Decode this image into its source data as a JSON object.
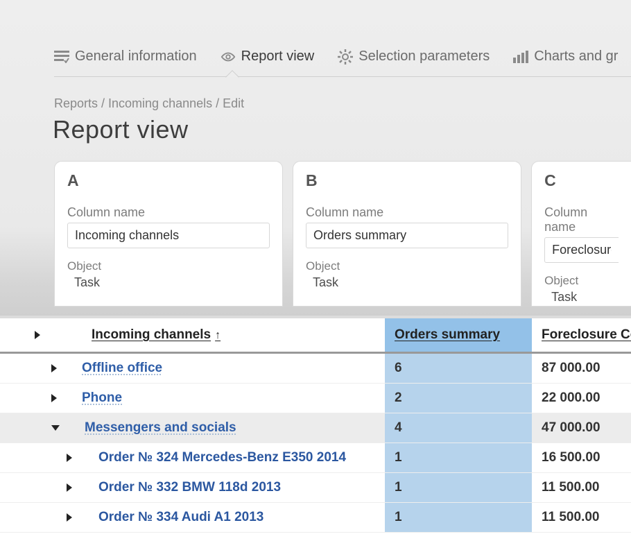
{
  "tabs": {
    "general": "General information",
    "report": "Report view",
    "selection": "Selection parameters",
    "charts": "Charts and gr"
  },
  "breadcrumbs": "Reports / Incoming channels / Edit",
  "page_title": "Report view",
  "columns": [
    {
      "letter": "A",
      "name_label": "Column name",
      "name_value": "Incoming channels",
      "object_label": "Object",
      "object_value": "Task"
    },
    {
      "letter": "B",
      "name_label": "Column name",
      "name_value": "Orders summary",
      "object_label": "Object",
      "object_value": "Task"
    },
    {
      "letter": "C",
      "name_label": "Column name",
      "name_value": "Foreclosure Co",
      "object_label": "Object",
      "object_value": "Task"
    }
  ],
  "table": {
    "headers": {
      "a": "Incoming channels",
      "b": "Orders summary",
      "c": "Foreclosure Co"
    },
    "sort_indicator": "↑",
    "rows": [
      {
        "label": "Offline office",
        "orders": "6",
        "cost": "87 000.00",
        "expanded": false,
        "level": 0
      },
      {
        "label": "Phone",
        "orders": "2",
        "cost": "22 000.00",
        "expanded": false,
        "level": 0
      },
      {
        "label": "Messengers and socials",
        "orders": "4",
        "cost": "47 000.00",
        "expanded": true,
        "level": 0
      },
      {
        "label": "Order № 324 Mercedes-Benz E350 2014",
        "orders": "1",
        "cost": "16 500.00",
        "expanded": false,
        "level": 1
      },
      {
        "label": "Order № 332 BMW 118d 2013",
        "orders": "1",
        "cost": "11 500.00",
        "expanded": false,
        "level": 1
      },
      {
        "label": "Order № 334 Audi A1 2013",
        "orders": "1",
        "cost": "11 500.00",
        "expanded": false,
        "level": 1
      }
    ]
  }
}
